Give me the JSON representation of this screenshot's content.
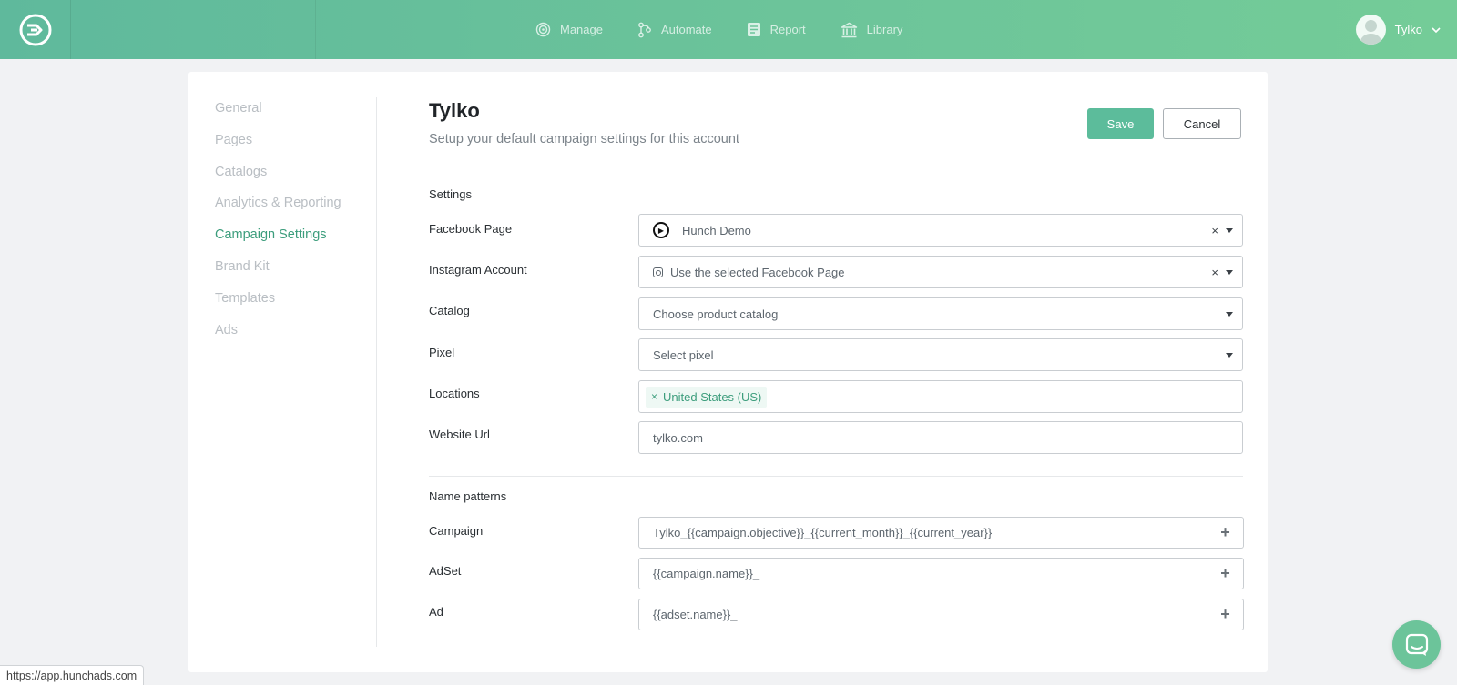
{
  "nav": {
    "items": [
      {
        "label": "Manage",
        "icon": "target-icon"
      },
      {
        "label": "Automate",
        "icon": "automate-icon"
      },
      {
        "label": "Report",
        "icon": "report-icon"
      },
      {
        "label": "Library",
        "icon": "library-icon"
      }
    ],
    "user_name": "Tylko"
  },
  "sidebar": {
    "items": [
      {
        "label": "General",
        "active": false
      },
      {
        "label": "Pages",
        "active": false
      },
      {
        "label": "Catalogs",
        "active": false
      },
      {
        "label": "Analytics & Reporting",
        "active": false
      },
      {
        "label": "Campaign Settings",
        "active": true
      },
      {
        "label": "Brand Kit",
        "active": false
      },
      {
        "label": "Templates",
        "active": false
      },
      {
        "label": "Ads",
        "active": false
      }
    ]
  },
  "header": {
    "title": "Tylko",
    "subtitle": "Setup your default campaign settings for this account",
    "save_label": "Save",
    "cancel_label": "Cancel"
  },
  "settings": {
    "section_label": "Settings",
    "facebook_page": {
      "label": "Facebook Page",
      "value": "Hunch Demo"
    },
    "instagram_account": {
      "label": "Instagram Account",
      "value": "Use the selected Facebook Page"
    },
    "catalog": {
      "label": "Catalog",
      "placeholder": "Choose product catalog"
    },
    "pixel": {
      "label": "Pixel",
      "placeholder": "Select pixel"
    },
    "locations": {
      "label": "Locations",
      "tags": [
        "United States (US)"
      ]
    },
    "website_url": {
      "label": "Website Url",
      "value": "tylko.com"
    }
  },
  "name_patterns": {
    "section_label": "Name patterns",
    "campaign": {
      "label": "Campaign",
      "value": "Tylko_{{campaign.objective}}_{{current_month}}_{{current_year}}"
    },
    "adset": {
      "label": "AdSet",
      "value": "{{campaign.name}}_"
    },
    "ad": {
      "label": "Ad",
      "value": "{{adset.name}}_"
    }
  },
  "status_url": "https://app.hunchads.com",
  "colors": {
    "brand_green": "#5cbc9b",
    "active_text": "#3c9d7c"
  }
}
